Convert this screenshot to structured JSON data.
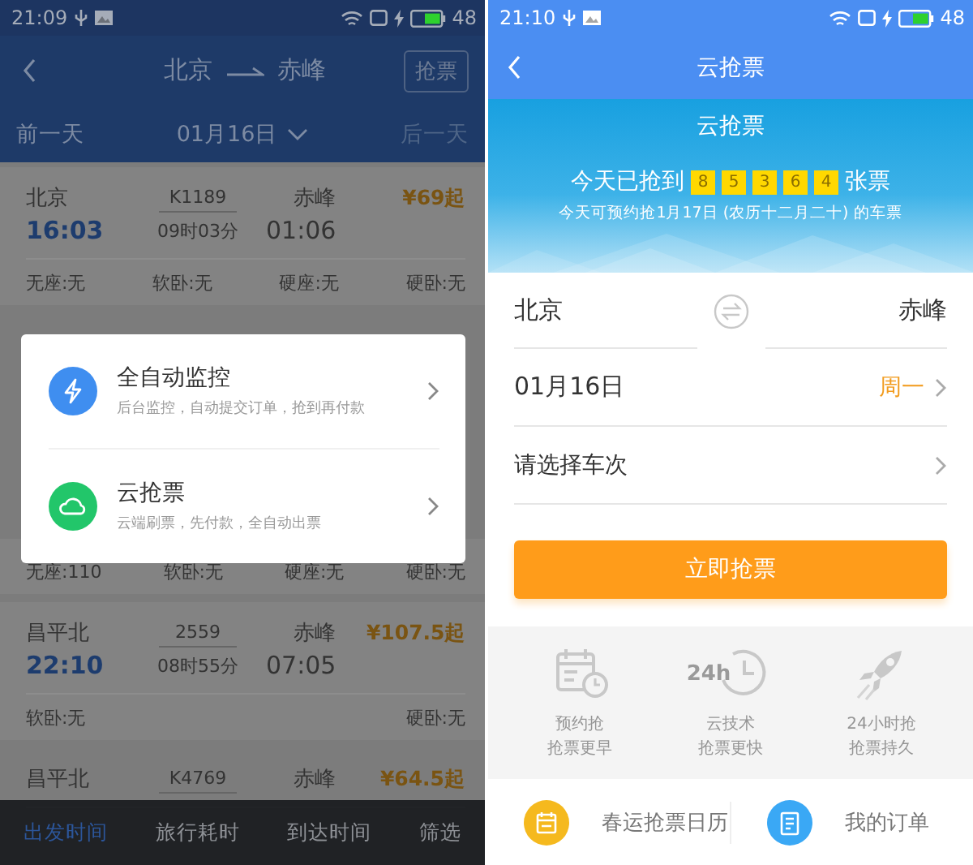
{
  "left_screen": {
    "status_bar": {
      "time": "21:09",
      "battery": "48"
    },
    "header": {
      "from": "北京",
      "to": "赤峰",
      "action": "抢票"
    },
    "date_bar": {
      "prev": "前一天",
      "date": "01月16日",
      "next": "后一天"
    },
    "trains": [
      {
        "from": "北京",
        "code": "K1189",
        "to": "赤峰",
        "price": "¥69起",
        "depart": "16:03",
        "duration": "09时03分",
        "arrive": "01:06",
        "seats": [
          "无座:无",
          "软卧:无",
          "硬座:无",
          "硬卧:无"
        ]
      },
      {
        "seats": [
          "无座:110",
          "软卧:无",
          "硬座:无",
          "硬卧:无"
        ]
      },
      {
        "from": "昌平北",
        "code": "2559",
        "to": "赤峰",
        "price": "¥107.5起",
        "depart": "22:10",
        "duration": "08时55分",
        "arrive": "07:05",
        "seats": [
          "软卧:无",
          "硬卧:无"
        ]
      },
      {
        "from": "昌平北",
        "code": "K4769",
        "to": "赤峰",
        "price": "¥64.5起"
      }
    ],
    "dialog": {
      "options": [
        {
          "kind": "bolt",
          "color": "#3f8ef0",
          "title": "全自动监控",
          "subtitle": "后台监控，自动提交订单，抢到再付款"
        },
        {
          "kind": "cloud",
          "color": "#22c66a",
          "title": "云抢票",
          "subtitle": "云端刷票，先付款，全自动出票"
        }
      ]
    },
    "sort_tabs": [
      {
        "label": "出发时间",
        "selected": true
      },
      {
        "label": "旅行耗时",
        "selected": false
      },
      {
        "label": "到达时间",
        "selected": false
      },
      {
        "label": "筛选",
        "selected": false
      }
    ]
  },
  "right_screen": {
    "status_bar": {
      "time": "21:10",
      "battery": "48"
    },
    "header": {
      "title": "云抢票"
    },
    "banner": {
      "title": "云抢票",
      "count_prefix": "今天已抢到",
      "digits": [
        "8",
        "5",
        "3",
        "6",
        "4"
      ],
      "count_suffix": "张票",
      "note": "今天可预约抢1月17日 (农历十二月二十) 的车票"
    },
    "form": {
      "from": "北京",
      "to": "赤峰",
      "date": "01月16日",
      "weekday": "周一",
      "train_placeholder": "请选择车次"
    },
    "submit": "立即抢票",
    "features": [
      {
        "kind": "calendar",
        "lines": [
          "预约抢",
          "抢票更早"
        ]
      },
      {
        "kind": "clock",
        "icon_text": "24h",
        "lines": [
          "云技术",
          "抢票更快"
        ]
      },
      {
        "kind": "rocket",
        "lines": [
          "24小时抢",
          "抢票持久"
        ]
      }
    ],
    "links": [
      {
        "kind": "calendar",
        "color": "#f5b91e",
        "label": "春运抢票日历"
      },
      {
        "kind": "order",
        "color": "#3aa8f5",
        "label": "我的订单"
      }
    ]
  }
}
